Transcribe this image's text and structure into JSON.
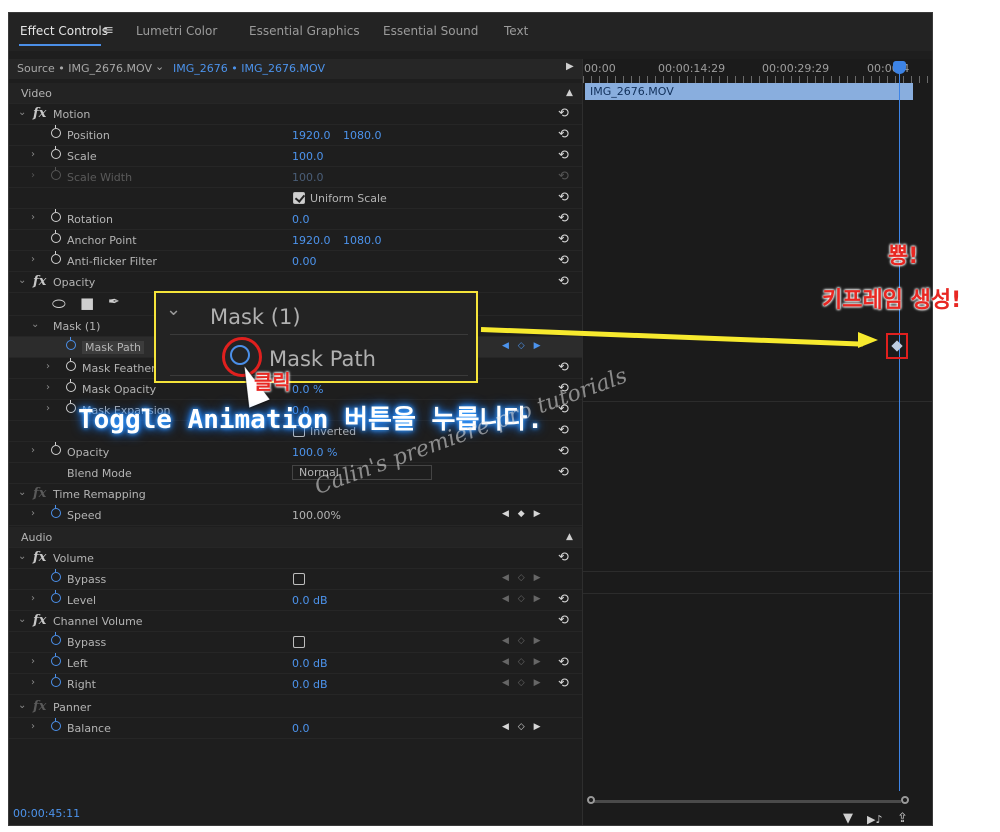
{
  "tabs": [
    {
      "label": "Effect Controls",
      "active": true
    },
    {
      "label": "Lumetri Color",
      "active": false
    },
    {
      "label": "Essential Graphics",
      "active": false
    },
    {
      "label": "Essential Sound",
      "active": false
    },
    {
      "label": "Text",
      "active": false
    }
  ],
  "menu_icon": "≡",
  "source": {
    "source_label": "Source • IMG_2676.MOV",
    "dropdown_glyph": "⌄",
    "active_label": "IMG_2676 • IMG_2676.MOV",
    "play_glyph": "▶"
  },
  "timeline": {
    "times": [
      "00:00",
      "00:00:14:29",
      "00:00:29:29",
      "00:00:4"
    ],
    "clip_label": "IMG_2676.MOV"
  },
  "sections": {
    "video": "Video",
    "audio": "Audio",
    "up_glyph": "▲"
  },
  "rows": {
    "motion": "Motion",
    "position": {
      "label": "Position",
      "x": "1920.0",
      "y": "1080.0"
    },
    "scale": {
      "label": "Scale",
      "value": "100.0"
    },
    "scale_width": {
      "label": "Scale Width",
      "value": "100.0"
    },
    "uniform_scale": "Uniform Scale",
    "rotation": {
      "label": "Rotation",
      "value": "0.0"
    },
    "anchor_point": {
      "label": "Anchor Point",
      "x": "1920.0",
      "y": "1080.0"
    },
    "anti_flicker": {
      "label": "Anti-flicker Filter",
      "value": "0.00"
    },
    "opacity_group": "Opacity",
    "mask": "Mask (1)",
    "mask_path": "Mask Path",
    "mask_feather": "Mask Feather",
    "mask_opacity": {
      "label": "Mask Opacity",
      "value": "0.0 %"
    },
    "mask_expansion": {
      "label": "Mask Expansion",
      "value": "0.0"
    },
    "inverted": "Inverted",
    "opacity": {
      "label": "Opacity",
      "value": "100.0 %"
    },
    "blend_mode": {
      "label": "Blend Mode",
      "value": "Normal"
    },
    "time_remapping": "Time Remapping",
    "speed": {
      "label": "Speed",
      "value": "100.00%"
    },
    "volume": "Volume",
    "bypass": "Bypass",
    "level": {
      "label": "Level",
      "value": "0.0 dB"
    },
    "channel_volume": "Channel Volume",
    "left": {
      "label": "Left",
      "value": "0.0 dB"
    },
    "right": {
      "label": "Right",
      "value": "0.0 dB"
    },
    "panner": "Panner",
    "balance": {
      "label": "Balance",
      "value": "0.0"
    }
  },
  "glyphs": {
    "expand": "›",
    "collapse": "⌄",
    "fx": "fx",
    "reset": "⟲",
    "kf_nav": "◀ ◇ ▶",
    "kf_nav_active": "◀ ◆ ▶",
    "ellipse_tool": "⬭",
    "rect_tool": "■",
    "pen_tool": "✒",
    "filter": "▼",
    "play_audio": "▶♪",
    "export": "⇪"
  },
  "status_time": "00:00:45:11",
  "zoom": {
    "mask_title": "Mask (1)",
    "mask_path": "Mask Path"
  },
  "annotations": {
    "click": "클릭",
    "instruction": "Toggle Animation 버튼을 누릅니다.",
    "pop": "뿅!",
    "keyframe_created": "키프레임 생성!",
    "watermark": "Calin's premiere pro tutorials"
  },
  "colors": {
    "accent_blue": "#4b8fe8",
    "highlight_yellow": "#f7ea2e",
    "annotation_red": "#e82722"
  }
}
